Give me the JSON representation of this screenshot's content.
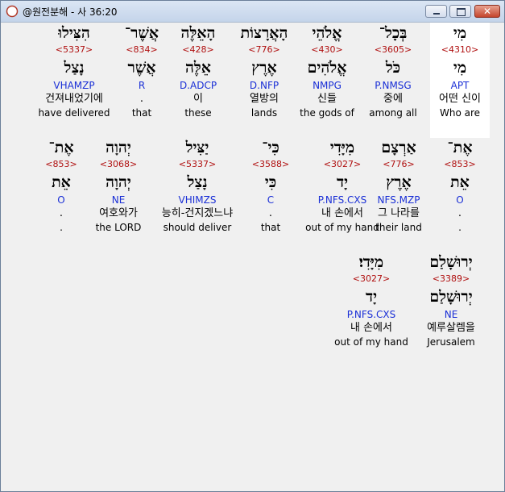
{
  "window": {
    "title": "@원전분해 - 사 36:20",
    "close_glyph": "✕"
  },
  "rows": [
    [
      {
        "heb": "מִי",
        "strong": "<4310>",
        "lex": "מִי",
        "morph": "APT",
        "kor": "어떤 신이",
        "eng": "Who are",
        "highlight": true
      },
      {
        "heb": "בְּכָל־",
        "strong": "<3605>",
        "lex": "כֹּל",
        "morph": "P.NMSG",
        "kor": "중에",
        "eng": "among all"
      },
      {
        "heb": "אֱלֹהֵי",
        "strong": "<430>",
        "lex": "אֱלֹהִים",
        "morph": "NMPG",
        "kor": "신들",
        "eng": "the gods of"
      },
      {
        "heb": "הָאֲרָצוֹת",
        "strong": "<776>",
        "lex": "אֶרֶץ",
        "morph": "D.NFP",
        "kor": "열방의",
        "eng": "lands"
      },
      {
        "heb": "הָאֵלֶּה",
        "strong": "<428>",
        "lex": "אֵלֶּה",
        "morph": "D.ADCP",
        "kor": "이",
        "eng": "these"
      },
      {
        "heb": "אֲשֶׁר־",
        "strong": "<834>",
        "lex": "אֲשֶׁר",
        "morph": "R",
        "kor": ".",
        "eng": "that"
      },
      {
        "heb": "הִצִּילוּ",
        "strong": "<5337>",
        "lex": "נָצַל",
        "morph": "VHAMZP",
        "kor": "건져내었기에",
        "eng": "have delivered"
      }
    ],
    [
      {
        "heb": "אֶת־",
        "strong": "<853>",
        "lex": "אֵת",
        "morph": "O",
        "kor": ".",
        "eng": "."
      },
      {
        "heb": "אַרְצָם",
        "strong": "<776>",
        "lex": "אֶרֶץ",
        "morph": "NFS.MZP",
        "kor": "그 나라를",
        "eng": "their land"
      },
      {
        "heb": "מִיָּדִי",
        "strong": "<3027>",
        "lex": "יָד",
        "morph": "P.NFS.CXS",
        "kor": "내 손에서",
        "eng": "out of my hand"
      },
      {
        "heb": "כִּי־",
        "strong": "<3588>",
        "lex": "כִּי",
        "morph": "C",
        "kor": ".",
        "eng": "that"
      },
      {
        "heb": "יַצִּיל",
        "strong": "<5337>",
        "lex": "נָצַל",
        "morph": "VHIMZS",
        "kor": "능히-건지겠느냐",
        "eng": "should deliver"
      },
      {
        "heb": "יְהוָה",
        "strong": "<3068>",
        "lex": "יְהוָה",
        "morph": "NE",
        "kor": "여호와가",
        "eng": "the LORD"
      },
      {
        "heb": "אֶת־",
        "strong": "<853>",
        "lex": "אֵת",
        "morph": "O",
        "kor": ".",
        "eng": "."
      }
    ],
    [
      {
        "heb": "יְרוּשָׁלַם",
        "strong": "<3389>",
        "lex": "יְרוּשָׁלַם",
        "morph": "NE",
        "kor": "예루살렘을",
        "eng": "Jerusalem"
      },
      {
        "heb": "מִיָּדִי׃",
        "strong": "<3027>",
        "lex": "יָד",
        "morph": "P.NFS.CXS",
        "kor": "내 손에서",
        "eng": "out of my hand"
      }
    ]
  ]
}
